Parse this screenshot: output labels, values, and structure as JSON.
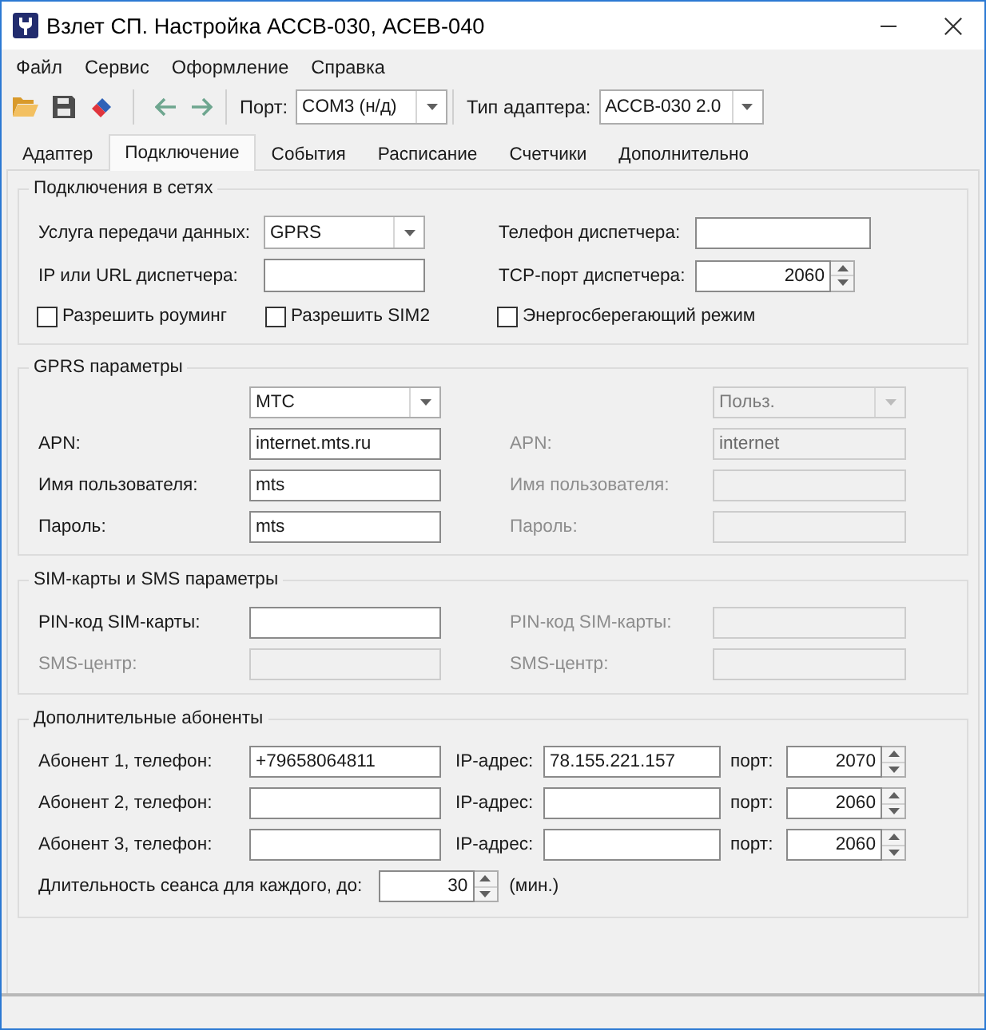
{
  "window": {
    "title": "Взлет СП. Настройка АССВ-030, АСЕВ-040"
  },
  "menu": [
    {
      "label": "Файл"
    },
    {
      "label": "Сервис"
    },
    {
      "label": "Оформление"
    },
    {
      "label": "Справка"
    }
  ],
  "toolbar": {
    "port": {
      "label": "Порт:",
      "value": "COM3 (н/д)"
    },
    "adapter_type": {
      "label": "Тип адаптера:",
      "value": "АССВ-030 2.0"
    }
  },
  "tabs": [
    {
      "label": "Адаптер",
      "selected": false
    },
    {
      "label": "Подключение",
      "selected": true
    },
    {
      "label": "События",
      "selected": false
    },
    {
      "label": "Расписание",
      "selected": false
    },
    {
      "label": "Счетчики",
      "selected": false
    },
    {
      "label": "Дополнительно",
      "selected": false
    }
  ],
  "network": {
    "title": "Подключения в сетях",
    "data_service": {
      "label": "Услуга передачи данных:",
      "value": "GPRS"
    },
    "dispatcher_phone": {
      "label": "Телефон диспетчера:"
    },
    "dispatcher_address": {
      "label": "IP или URL диспетчера:"
    },
    "tcp_port": {
      "label": "TCP-порт диспетчера:",
      "value": "2060"
    },
    "options": [
      {
        "label": "Разрешить роуминг",
        "checked": false
      },
      {
        "label": "Разрешить SIM2",
        "checked": false
      },
      {
        "label": "Энергосберегающий режим",
        "checked": false
      }
    ]
  },
  "gprs": {
    "title": "GPRS параметры",
    "columns": [
      {
        "operator": {
          "value": "МТС",
          "disabled": false
        },
        "fields": [
          {
            "label": "APN:",
            "value": "internet.mts.ru",
            "disabled": false
          },
          {
            "label": "Имя пользователя:",
            "value": "mts",
            "disabled": false
          },
          {
            "label": "Пароль:",
            "value": "mts",
            "disabled": false
          }
        ]
      },
      {
        "operator": {
          "value": "Польз.",
          "disabled": true
        },
        "fields": [
          {
            "label": "APN:",
            "value": "internet",
            "disabled": true
          },
          {
            "label": "Имя пользователя:",
            "disabled": true
          },
          {
            "label": "Пароль:",
            "disabled": true
          }
        ]
      }
    ]
  },
  "sim": {
    "title": "SIM-карты и SMS параметры",
    "columns": [
      {
        "fields": [
          {
            "label": "PIN-код SIM-карты:",
            "disabled": false
          },
          {
            "label": "SMS-центр:",
            "disabled": true
          }
        ]
      },
      {
        "fields": [
          {
            "label": "PIN-код SIM-карты:",
            "disabled": true
          },
          {
            "label": "SMS-центр:",
            "disabled": true
          }
        ]
      }
    ]
  },
  "subscribers": {
    "title": "Дополнительные абоненты",
    "rows": [
      {
        "phone": {
          "label": "Абонент 1, телефон:",
          "value": "+79658064811"
        },
        "ip": {
          "label": "IP-адрес:",
          "value": "78.155.221.157"
        },
        "port": {
          "label": "порт:",
          "value": "2070"
        }
      },
      {
        "phone": {
          "label": "Абонент 2, телефон:"
        },
        "ip": {
          "label": "IP-адрес:"
        },
        "port": {
          "label": "порт:",
          "value": "2060"
        }
      },
      {
        "phone": {
          "label": "Абонент 3, телефон:"
        },
        "ip": {
          "label": "IP-адрес:"
        },
        "port": {
          "label": "порт:",
          "value": "2060"
        }
      }
    ],
    "session": {
      "label": "Длительность сеанса для каждого, до:",
      "value": "30",
      "unit": "(мин.)"
    }
  }
}
